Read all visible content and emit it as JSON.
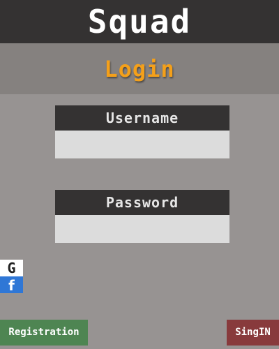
{
  "header": {
    "title": "Squad",
    "background": "#343232"
  },
  "login": {
    "title": "Login",
    "title_color": "#f4a01a"
  },
  "form": {
    "username_label": "Username",
    "username_value": "",
    "password_label": "Password",
    "password_value": ""
  },
  "social": {
    "google_label": "G",
    "google_icon": "google-icon",
    "facebook_label": "f",
    "facebook_icon": "facebook-icon",
    "facebook_color": "#2f77d6"
  },
  "actions": {
    "registration_label": "Registration",
    "registration_color": "#4e8552",
    "signin_label": "SingIN",
    "signin_color": "#883a3c"
  }
}
